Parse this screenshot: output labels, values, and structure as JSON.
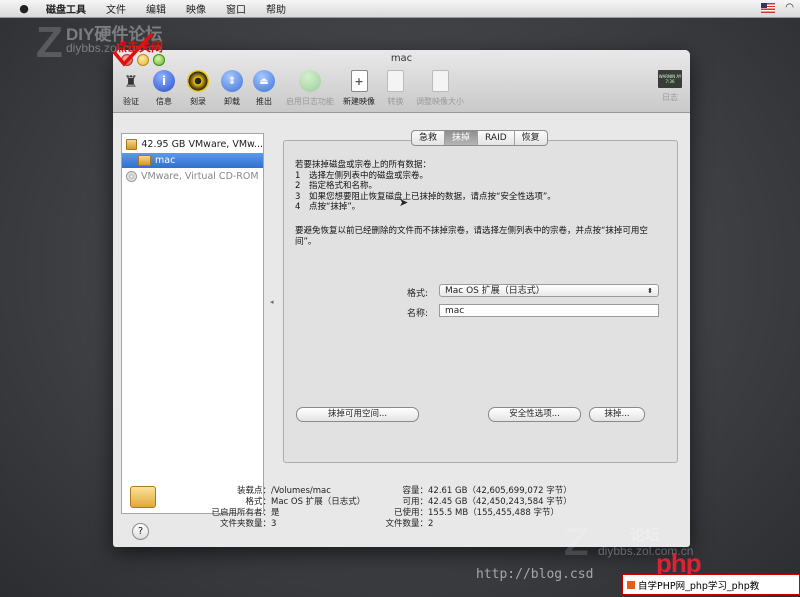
{
  "menubar": {
    "items": [
      "磁盘工具",
      "文件",
      "编辑",
      "映像",
      "窗口",
      "帮助"
    ]
  },
  "watermarks": {
    "top_line1": "DIY硬件论坛",
    "top_line2": "diybbs.zol.com.cn",
    "bottom_line1": "论坛",
    "bottom_line2": "diybbs.zol.com.cn",
    "url": "http://blog.csd",
    "php_logo": "php",
    "php_badge": "自学PHP网_php学习_php教"
  },
  "window": {
    "title": "mac",
    "annotation": "点击关闭",
    "toolbar": [
      {
        "label": "验证",
        "icon": "microscope-icon",
        "enabled": true
      },
      {
        "label": "信息",
        "icon": "info-icon",
        "enabled": true
      },
      {
        "label": "刻录",
        "icon": "burn-icon",
        "enabled": true
      },
      {
        "label": "卸载",
        "icon": "unmount-icon",
        "enabled": true
      },
      {
        "label": "推出",
        "icon": "eject-icon",
        "enabled": true
      },
      {
        "label": "启用日志功能",
        "icon": "journal-icon",
        "enabled": false
      },
      {
        "label": "新建映像",
        "icon": "new-image-icon",
        "enabled": true
      },
      {
        "label": "转换",
        "icon": "convert-icon",
        "enabled": false
      },
      {
        "label": "调整映像大小",
        "icon": "resize-image-icon",
        "enabled": false
      },
      {
        "label": "日志",
        "icon": "log-icon",
        "enabled": false
      }
    ],
    "log_icon_text": "WARNIN AY 7:36"
  },
  "sidebar": {
    "items": [
      {
        "label": "42.95 GB VMware, VMw...",
        "type": "disk",
        "selected": false
      },
      {
        "label": "mac",
        "type": "volume",
        "selected": true
      },
      {
        "label": "VMware, Virtual CD-ROM",
        "type": "cdrom",
        "selected": false
      }
    ]
  },
  "tabs": [
    {
      "label": "急救",
      "active": false
    },
    {
      "label": "抹掉",
      "active": true
    },
    {
      "label": "RAID",
      "active": false
    },
    {
      "label": "恢复",
      "active": false
    }
  ],
  "erase": {
    "heading": "若要抹掉磁盘或宗卷上的所有数据：",
    "steps": [
      {
        "n": "1",
        "text": "选择左侧列表中的磁盘或宗卷。"
      },
      {
        "n": "2",
        "text": "指定格式和名称。"
      },
      {
        "n": "3",
        "text": "如果您想要阻止恢复磁盘上已抹掉的数据，请点按“安全性选项”。"
      },
      {
        "n": "4",
        "text": "点按“抹掉”。"
      }
    ],
    "note": "要避免恢复以前已经删除的文件而不抹掉宗卷，请选择左侧列表中的宗卷，并点按“抹掉可用空间”。",
    "format_label": "格式:",
    "format_value": "Mac OS 扩展（日志式）",
    "name_label": "名称:",
    "name_value": "mac",
    "erase_free_space": "抹掉可用空间...",
    "security_options": "安全性选项...",
    "erase_button": "抹掉..."
  },
  "info": {
    "mount_point_label": "装载点：",
    "mount_point": "/Volumes/mac",
    "format_label": "格式：",
    "format": "Mac OS 扩展（日志式）",
    "owners_label": "已启用所有者：",
    "owners": "是",
    "folders_label": "文件夹数量：",
    "folders": "3",
    "capacity_label": "容量：",
    "capacity": "42.61 GB（42,605,699,072 字节）",
    "available_label": "可用：",
    "available": "42.45 GB（42,450,243,584 字节）",
    "used_label": "已使用：",
    "used": "155.5 MB（155,455,488 字节）",
    "files_label": "文件数量：",
    "files": "2",
    "help": "?"
  }
}
